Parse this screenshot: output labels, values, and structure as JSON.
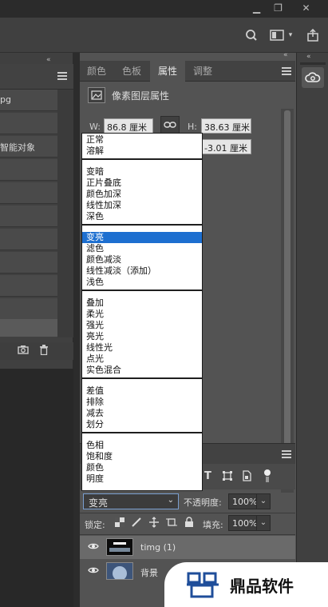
{
  "window": {
    "controls": [
      "minimize-icon",
      "restore-icon",
      "close-icon"
    ]
  },
  "options_bar": {
    "icons": [
      "search-icon",
      "workspace-icon",
      "chevron-down-icon",
      "share-icon"
    ]
  },
  "left_panel": {
    "collapse_glyph": "«",
    "rows": [
      "pg",
      "",
      "智能对象",
      "",
      "",
      "",
      "",
      "",
      "",
      ""
    ]
  },
  "properties_panel": {
    "tabs": [
      "颜色",
      "色板",
      "属性",
      "调整"
    ],
    "active_tab": "属性",
    "title": "像素图层属性",
    "w_label": "W:",
    "w_value": "86.8 厘米",
    "h_label": "H:",
    "h_value": "38.63 厘米",
    "y_value": "-3.01 厘米"
  },
  "blend_dropdown": {
    "groups": [
      [
        "正常",
        "溶解"
      ],
      [
        "变暗",
        "正片叠底",
        "颜色加深",
        "线性加深",
        "深色"
      ],
      [
        "变亮",
        "滤色",
        "颜色减淡",
        "线性减淡（添加）",
        "浅色"
      ],
      [
        "叠加",
        "柔光",
        "强光",
        "亮光",
        "线性光",
        "点光",
        "实色混合"
      ],
      [
        "差值",
        "排除",
        "减去",
        "划分"
      ],
      [
        "色相",
        "饱和度",
        "颜色",
        "明度"
      ]
    ],
    "selected": "变亮"
  },
  "layers_panel": {
    "blend_mode": "变亮",
    "opacity_label": "不透明度:",
    "opacity_value": "100%",
    "lock_label": "锁定:",
    "fill_label": "填充:",
    "fill_value": "100%",
    "layers": [
      {
        "name": "timg (1)"
      },
      {
        "name": "背景"
      }
    ]
  },
  "watermark": {
    "text": "鼎品软件"
  },
  "colors": {
    "highlight": "#1d6fd0",
    "panel_bg": "#535353"
  }
}
